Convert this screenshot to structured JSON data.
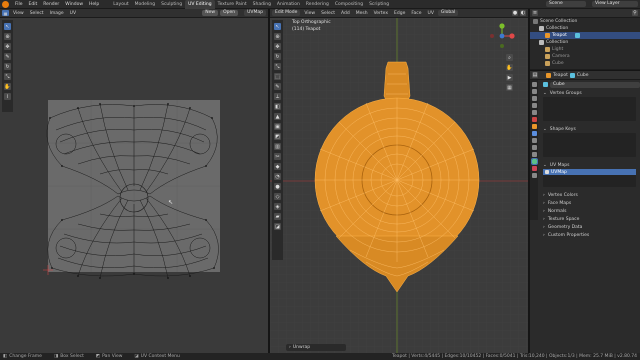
{
  "topbar": {
    "menus": [
      "File",
      "Edit",
      "Render",
      "Window",
      "Help"
    ],
    "workspaces": [
      "Layout",
      "Modeling",
      "Sculpting",
      "UV Editing",
      "Texture Paint",
      "Shading",
      "Animation",
      "Rendering",
      "Compositing",
      "Scripting"
    ],
    "active_workspace": "UV Editing",
    "scene_label": "Scene",
    "view_layer_label": "View Layer"
  },
  "uv_editor": {
    "header": [
      "View",
      "Select",
      "Image",
      "UV"
    ],
    "image_button": "New",
    "open_button": "Open",
    "uvmap_label": "UVMap"
  },
  "viewport": {
    "header": [
      "View",
      "Select",
      "Add",
      "Mesh",
      "Vertex",
      "Edge",
      "Face",
      "UV"
    ],
    "mode_label": "Edit Mode",
    "transform_label": "Global",
    "view_name": "Top Orthographic",
    "object_info": "(114) Teapot",
    "operator_panel": "Unwrap"
  },
  "outliner": {
    "title": "Scene Collection",
    "rows": [
      {
        "label": "Scene Collection",
        "indent": 0,
        "selected": false
      },
      {
        "label": "Collection",
        "indent": 1,
        "selected": false
      },
      {
        "label": "Teapot",
        "indent": 2,
        "selected": true
      },
      {
        "label": "Collection",
        "indent": 1,
        "selected": false
      },
      {
        "label": "Light",
        "indent": 2,
        "selected": false
      },
      {
        "label": "Camera",
        "indent": 2,
        "selected": false
      },
      {
        "label": "Cube",
        "indent": 2,
        "selected": false
      }
    ]
  },
  "properties": {
    "object_name": "Teapot",
    "mesh_name": "Cube",
    "data_name": "Cube",
    "sections": [
      "Vertex Groups",
      "Shape Keys",
      "UV Maps"
    ],
    "uv_map_entry": "UVMap",
    "collapsed_sections": [
      "Vertex Colors",
      "Face Maps",
      "Normals",
      "Texture Space",
      "Geometry Data",
      "Custom Properties"
    ]
  },
  "statusbar": {
    "left": [
      "Change Frame",
      "Box Select",
      "Pan View",
      "UV Context Menu"
    ],
    "right": "Teapot | Verts:4/5445 | Edges:10/10452 | Faces:0/5041 | Tris:10,240 | Objects:1/3 | Mem: 25.7 MiB | v2.80.74"
  },
  "colors": {
    "accent": "#4772b3",
    "mesh_orange": "#e8962a",
    "grid_bg": "#3c3c3c",
    "uv_canvas": "#6a6a6a"
  },
  "icons": {
    "select": "cursor-icon",
    "transform": "move-icon",
    "annotate": "pencil-icon",
    "cursor": "crosshair-icon"
  }
}
